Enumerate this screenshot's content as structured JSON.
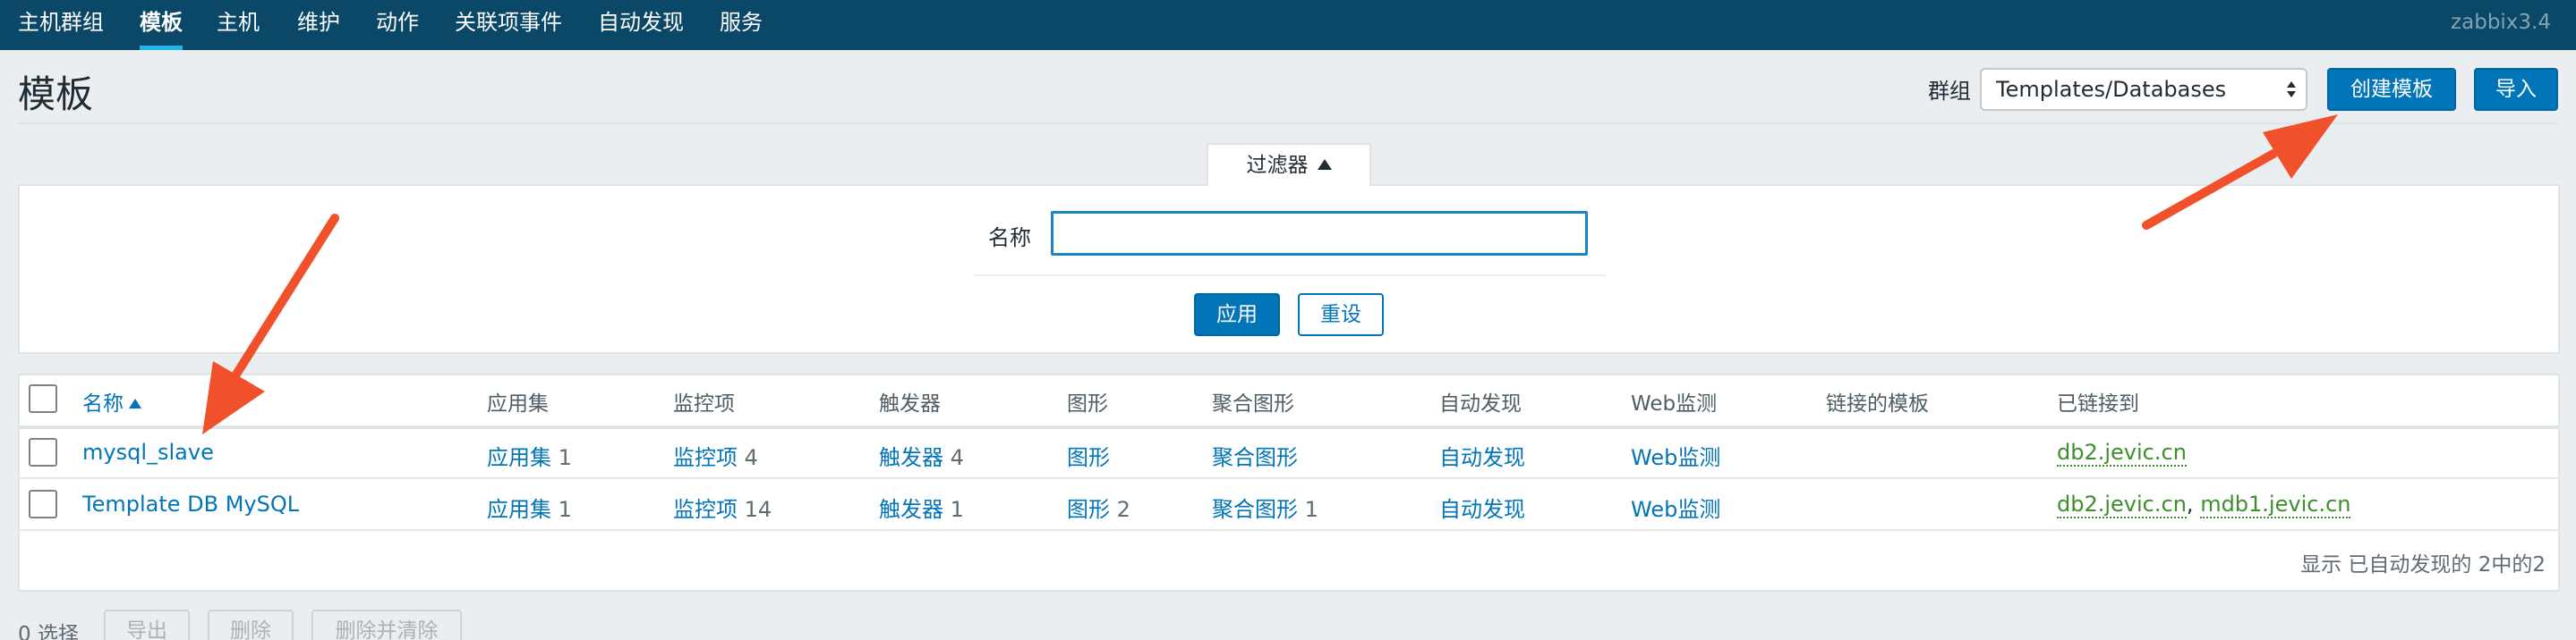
{
  "topnav": {
    "items": [
      "主机群组",
      "模板",
      "主机",
      "维护",
      "动作",
      "关联项事件",
      "自动发现",
      "服务"
    ],
    "brand": "zabbix3.4"
  },
  "header": {
    "title": "模板",
    "group_label": "群组",
    "group_value": "Templates/Databases",
    "create_label": "创建模板",
    "import_label": "导入"
  },
  "filter": {
    "tab_label": "过滤器",
    "name_label": "名称",
    "name_value": "",
    "apply_label": "应用",
    "reset_label": "重设"
  },
  "table": {
    "columns": [
      "名称",
      "应用集",
      "监控项",
      "触发器",
      "图形",
      "聚合图形",
      "自动发现",
      "Web监测",
      "链接的模板",
      "已链接到"
    ],
    "rows": [
      {
        "name": "mysql_slave",
        "apps": "应用集",
        "apps_count": "1",
        "items": "监控项",
        "items_count": "4",
        "triggers": "触发器",
        "triggers_count": "4",
        "graphs": "图形",
        "graphs_count": "",
        "screens": "聚合图形",
        "screens_count": "",
        "discovery": "自动发现",
        "web": "Web监测",
        "linked_to": [
          "db2.jevic.cn"
        ]
      },
      {
        "name": "Template DB MySQL",
        "apps": "应用集",
        "apps_count": "1",
        "items": "监控项",
        "items_count": "14",
        "triggers": "触发器",
        "triggers_count": "1",
        "graphs": "图形",
        "graphs_count": "2",
        "screens": "聚合图形",
        "screens_count": "1",
        "discovery": "自动发现",
        "web": "Web监测",
        "linked_to": [
          "db2.jevic.cn",
          "mdb1.jevic.cn"
        ],
        "linked_sep": ","
      }
    ],
    "footer": "显示 已自动发现的 2中的2"
  },
  "actions": {
    "selected": "0 选择",
    "export": "导出",
    "delete": "删除",
    "delete_clear": "删除并清除"
  },
  "colors": {
    "nav_bg": "#0b4766",
    "accent": "#0275b8",
    "host_link": "#3e8e2e",
    "annotation_arrow": "#f0502a"
  }
}
